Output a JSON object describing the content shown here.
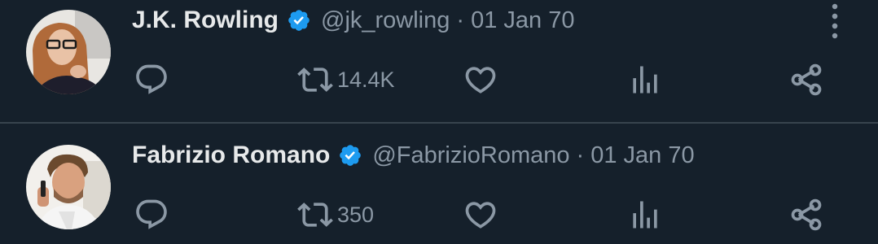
{
  "tweets": [
    {
      "author_name": "J.K. Rowling",
      "handle": "@jk_rowling",
      "separator": "·",
      "date": "01 Jan 70",
      "verified": true,
      "retweet_count": "14.4K"
    },
    {
      "author_name": "Fabrizio Romano",
      "handle": "@FabrizioRomano",
      "separator": "·",
      "date": "01 Jan 70",
      "verified": true,
      "retweet_count": "350"
    }
  ],
  "icons": {
    "reply": "reply-icon",
    "retweet": "retweet-icon",
    "like": "heart-icon",
    "views": "views-icon",
    "share": "share-icon",
    "more": "more-options-icon",
    "verified": "verified-badge-icon"
  },
  "colors": {
    "background": "#15202b",
    "text_primary": "#e7e9ea",
    "text_secondary": "#8b98a5",
    "verified_blue": "#1d9bf0",
    "divider": "#38444d"
  }
}
